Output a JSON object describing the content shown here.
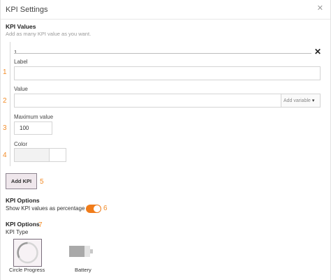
{
  "window": {
    "title": "KPI Settings",
    "close_icon": "close-icon"
  },
  "kpi_values": {
    "heading": "KPI Values",
    "subtitle": "Add as many KPI value as you want.",
    "items": [
      {
        "index": "1",
        "label_field": {
          "label": "Label",
          "value": ""
        },
        "value_field": {
          "label": "Value",
          "value": "",
          "variable_dropdown": "Add variable"
        },
        "max_field": {
          "label": "Maximum value",
          "value": "100"
        },
        "color_field": {
          "label": "Color",
          "value": ""
        }
      }
    ],
    "add_button": "Add KPI"
  },
  "kpi_options": {
    "heading": "KPI Options",
    "show_percentage_label": "Show KPI values as percentage",
    "show_percentage_enabled": true
  },
  "kpi_type": {
    "heading": "KPI Options",
    "subheading": "KPI Type",
    "options": [
      {
        "label": "Circle Progress",
        "icon": "circle-progress-icon",
        "selected": true
      },
      {
        "label": "Battery",
        "icon": "battery-icon",
        "selected": false
      }
    ]
  },
  "step_markers": [
    "1",
    "2",
    "3",
    "4",
    "5",
    "6",
    "7"
  ],
  "colors": {
    "accent": "#f07c1a",
    "step_marker": "#f28c28",
    "selected_border": "#7a6e7c",
    "button_bg": "#efe7ec"
  }
}
